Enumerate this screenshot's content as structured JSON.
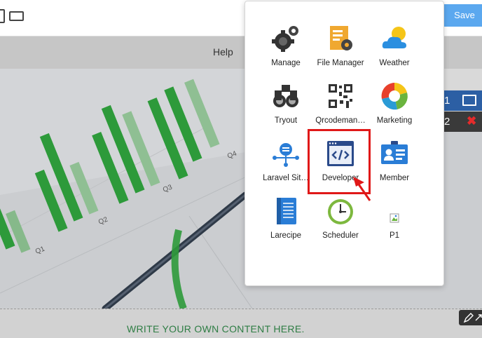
{
  "toolbar": {
    "save_label": "Save"
  },
  "nav": {
    "help_label": "Help"
  },
  "hero": {
    "bar_labels": [
      "Q1",
      "Q2",
      "Q3",
      "Q4"
    ]
  },
  "content": {
    "placeholder_text": "WRITE YOUR OWN CONTENT HERE."
  },
  "side_rows": [
    {
      "number": "1"
    },
    {
      "number": "2"
    }
  ],
  "apps": [
    {
      "label": "Manage",
      "icon": "gears-icon"
    },
    {
      "label": "File Manager",
      "icon": "file-manager-icon"
    },
    {
      "label": "Weather",
      "icon": "weather-icon"
    },
    {
      "label": "Tryout",
      "icon": "binoculars-icon"
    },
    {
      "label": "Qrcodeman…",
      "icon": "qrcode-icon"
    },
    {
      "label": "Marketing",
      "icon": "marketing-icon"
    },
    {
      "label": "Laravel Sit…",
      "icon": "sitemap-icon"
    },
    {
      "label": "Developer",
      "icon": "code-window-icon"
    },
    {
      "label": "Member",
      "icon": "member-card-icon"
    },
    {
      "label": "Larecipe",
      "icon": "notebook-icon"
    },
    {
      "label": "Scheduler",
      "icon": "clock-icon"
    },
    {
      "label": "P1",
      "icon": "broken-image-icon"
    }
  ],
  "highlight": {
    "app": "Developer",
    "color": "#e01818"
  },
  "colors": {
    "save_button": "#5ba8ef",
    "accent_green": "#2e7d44",
    "row_blue": "#2c5fa4"
  }
}
